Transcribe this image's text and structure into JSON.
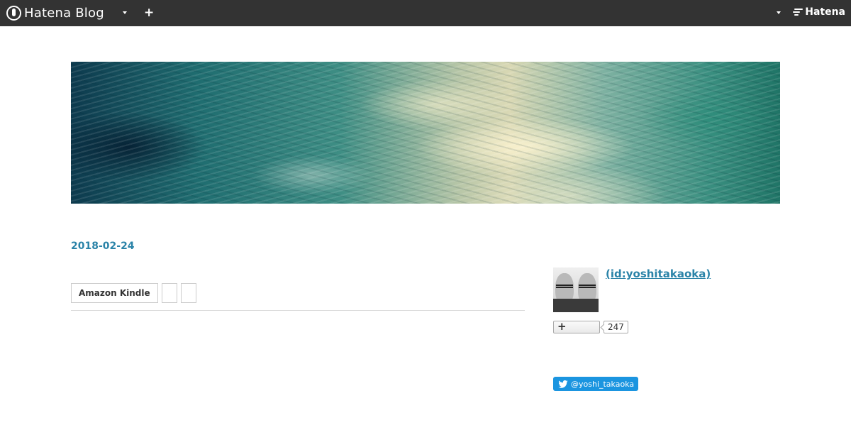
{
  "globalheader": {
    "logo_text": "Hatena Blog",
    "add_icon": "plus-icon",
    "brand_text": "Hatena"
  },
  "entry": {
    "date": "2018-02-24",
    "categories": [
      "Amazon Kindle",
      "",
      ""
    ]
  },
  "sidebar": {
    "profile": {
      "name": " (id:yoshitakaoka)"
    },
    "subscribe": {
      "icon": "plus-icon",
      "count": "247"
    },
    "twitter": {
      "handle": "@yoshi_takaoka"
    }
  },
  "colors": {
    "header_bg": "#333333",
    "link": "#2a83a8",
    "twitter": "#1b95e0"
  }
}
